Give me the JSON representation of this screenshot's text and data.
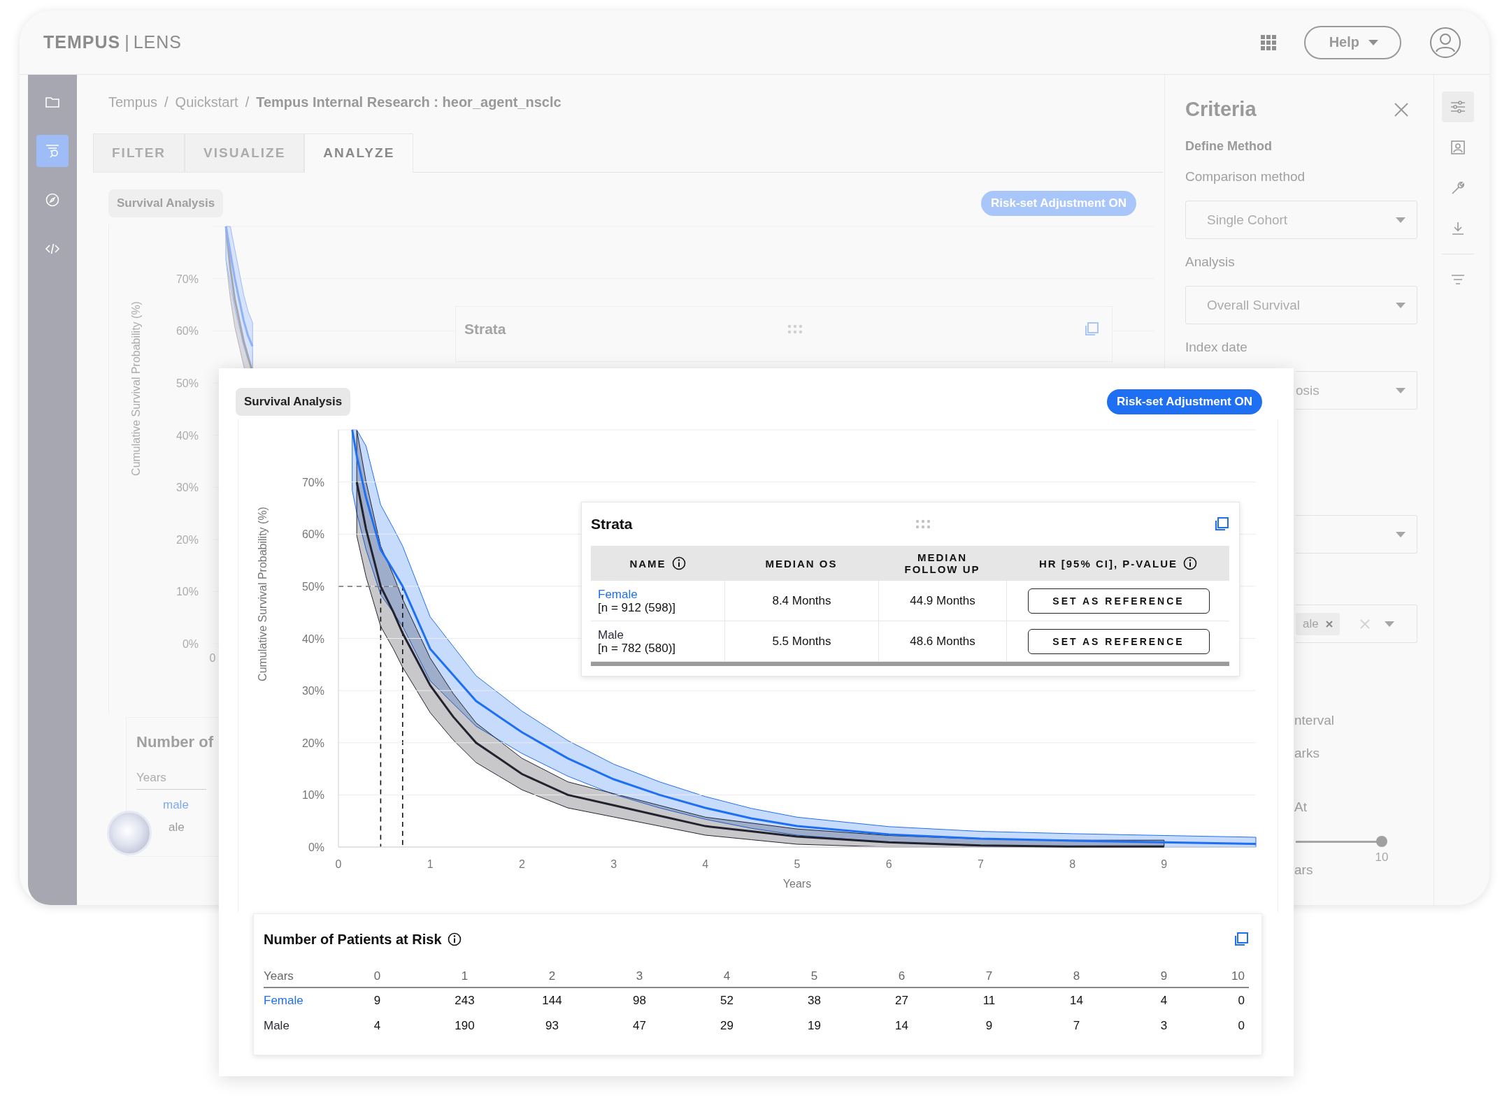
{
  "header": {
    "logo_brand": "TEMPUS",
    "logo_separator": "|",
    "logo_product": "LENS",
    "help_button": "Help"
  },
  "sidebar": {
    "items": [
      {
        "kind": "folder",
        "selected": false
      },
      {
        "kind": "filter-search",
        "selected": true
      },
      {
        "kind": "compass",
        "selected": false
      },
      {
        "kind": "code",
        "selected": false
      }
    ]
  },
  "breadcrumbs": [
    {
      "label": "Tempus",
      "current": false
    },
    {
      "separator": "/",
      "label": "Quickstart",
      "current": false
    },
    {
      "separator": "/",
      "label": "Tempus Internal Research : heor_agent_nsclc",
      "current": true
    }
  ],
  "tabs": [
    {
      "label": "FILTER",
      "selected": false
    },
    {
      "label": "VISUALIZE",
      "selected": false
    },
    {
      "label": "ANALYZE",
      "selected": true
    }
  ],
  "background_view": {
    "chip": "Survival Analysis",
    "risk_button": "Risk-set Adjustment ON",
    "axis": {
      "ylabel": "Cumulative Survival Probability (%)",
      "y_labels": [
        "70%",
        "60%",
        "50%",
        "40%",
        "30%",
        "20%",
        "10%",
        "0%"
      ],
      "x_label": "0"
    },
    "strata_title": "Strata",
    "risk_panel": {
      "title": "Number of",
      "header": "Years",
      "rows": [
        {
          "name": "male",
          "color": "#7fa8f2"
        },
        {
          "name": "ale",
          "color": "#9a9a9a"
        }
      ]
    }
  },
  "criteria": {
    "title": "Criteria",
    "section": "Define Method",
    "items": [
      {
        "kind": "select",
        "label": "Comparison method",
        "value": "Single Cohort"
      },
      {
        "kind": "select",
        "label": "Analysis",
        "value": "Overall Survival"
      },
      {
        "kind": "select_covered",
        "label": "Index date",
        "value": "osis"
      },
      {
        "kind": "select_empty"
      },
      {
        "kind": "multiselect",
        "chips": [
          "ale"
        ]
      },
      {
        "kind": "checkbox_label",
        "label": "nterval"
      },
      {
        "kind": "checkbox_label",
        "label": "arks"
      },
      {
        "kind": "section_label",
        "label": "At"
      },
      {
        "kind": "slider",
        "level": 1,
        "value_label": "10"
      },
      {
        "kind": "caption",
        "label": "ars"
      }
    ]
  },
  "rail": {
    "items": [
      {
        "kind": "sliders",
        "selected": true
      },
      {
        "kind": "person",
        "selected": false
      },
      {
        "kind": "wrench",
        "selected": false
      },
      {
        "kind": "download",
        "selected": false
      },
      {
        "kind": "filter",
        "selected": false
      }
    ]
  },
  "overlay": {
    "chip": "Survival Analysis",
    "risk_button": "Risk-set Adjustment ON",
    "chart_data": {
      "type": "line",
      "xlabel": "Years",
      "ylabel": "Cumulative Survival Probability (%)",
      "grid": true,
      "x": [
        0.15,
        0.2,
        0.3,
        0.46,
        0.6,
        0.7,
        0.85,
        1,
        1.25,
        1.5,
        1.75,
        2,
        2.5,
        3,
        3.5,
        4,
        4.5,
        5,
        6,
        7,
        8,
        9,
        10
      ],
      "xlim": [
        0,
        10
      ],
      "ylim": [
        0,
        80
      ],
      "xticks": [
        0,
        1,
        2,
        3,
        4,
        5,
        6,
        7,
        8,
        9
      ],
      "yticks": [
        {
          "value": 0,
          "label": "0%"
        },
        {
          "value": 10,
          "label": "10%"
        },
        {
          "value": 20,
          "label": "20%"
        },
        {
          "value": 30,
          "label": "30%"
        },
        {
          "value": 40,
          "label": "40%"
        },
        {
          "value": 50,
          "label": "50%"
        },
        {
          "value": 60,
          "label": "60%"
        },
        {
          "value": 70,
          "label": "70%"
        }
      ],
      "series": [
        {
          "color": "#1f6ff2",
          "values": [
            80,
            75,
            67,
            57,
            53,
            50,
            44,
            38,
            33,
            28,
            25,
            22,
            17,
            13,
            10,
            7.5,
            5.5,
            4,
            2.4,
            1.6,
            1.2,
            0.9,
            0.6
          ]
        },
        {
          "color": "#23232f",
          "values": [
            null,
            70,
            61,
            50,
            45,
            41,
            36,
            31,
            25,
            20,
            17,
            14,
            10,
            8,
            6,
            4,
            3,
            2,
            0.9,
            0.3,
            0.1,
            0.1,
            null
          ]
        }
      ]
    },
    "strata": {
      "title": "Strata",
      "columns": [
        {
          "label": "NAME",
          "info": true
        },
        {
          "label": "MEDIAN OS",
          "info": false
        },
        {
          "label": "MEDIAN FOLLOW UP",
          "info": false
        },
        {
          "label": "HR [95% CI], P-VALUE",
          "info": true
        }
      ],
      "rows": [
        {
          "name": "Female",
          "color": "#1f6ff2",
          "n": "[n = 912 (598)]",
          "median_os": "8.4 Months",
          "median_follow_up": "44.9 Months",
          "button": "SET AS REFERENCE"
        },
        {
          "name": "Male",
          "color": "#2b2b3a",
          "n": "[n = 782 (580)]",
          "median_os": "5.5 Months",
          "median_follow_up": "48.6 Months",
          "button": "SET AS REFERENCE"
        }
      ]
    },
    "risk_table": {
      "title": "Number of Patients at Risk",
      "columns": [
        "Years",
        "0",
        "1",
        "2",
        "3",
        "4",
        "5",
        "6",
        "7",
        "8",
        "9",
        "10"
      ],
      "rows": [
        {
          "name": "Female",
          "color": "#1f6ff2",
          "values": [
            "9",
            "243",
            "144",
            "98",
            "52",
            "38",
            "27",
            "11",
            "14",
            "4",
            "0"
          ]
        },
        {
          "name": "Male",
          "color": "#2b2b3a",
          "values": [
            "4",
            "190",
            "93",
            "47",
            "29",
            "19",
            "14",
            "9",
            "7",
            "3",
            "0"
          ]
        }
      ]
    }
  }
}
